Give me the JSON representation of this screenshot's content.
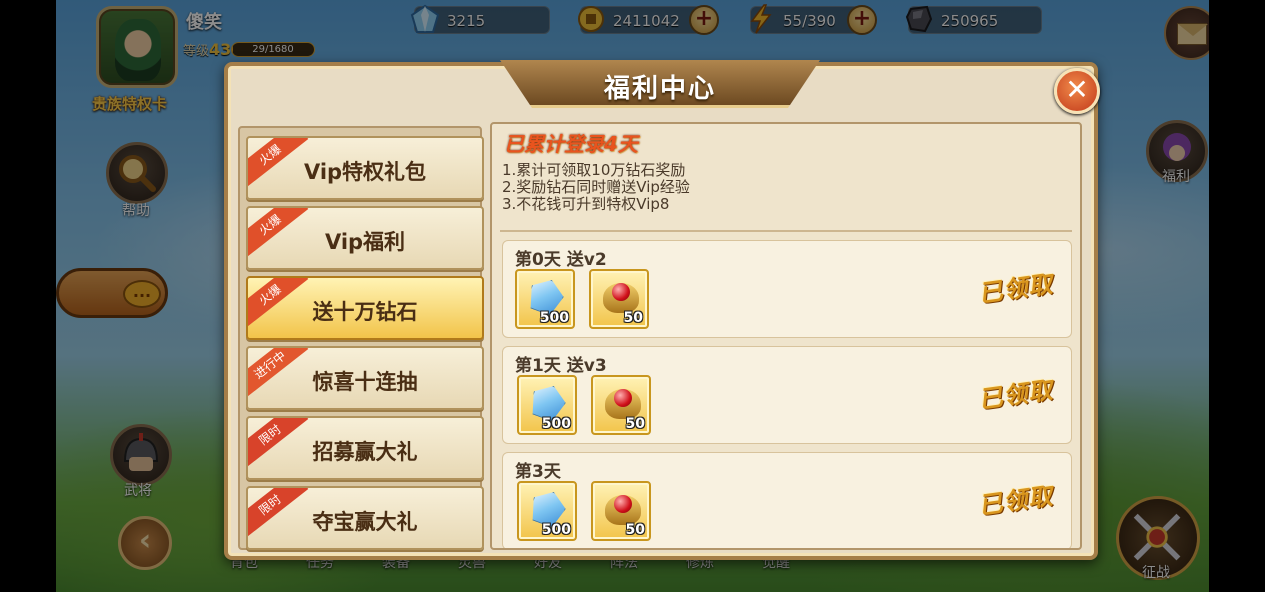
{
  "header": {
    "player_name": "傻笑",
    "level_label": "等级",
    "level": "43",
    "exp_text": "29/1680",
    "exp_progress": 0.017,
    "privilege_card_label": "贵族特权卡",
    "resources": [
      {
        "name": "diamond",
        "icon": "diamond-icon",
        "value": "3215"
      },
      {
        "name": "gold",
        "icon": "coin-icon",
        "value": "2411042"
      },
      {
        "name": "stamina",
        "icon": "lightning-icon",
        "value": "55/390"
      },
      {
        "name": "stone",
        "icon": "stone-icon",
        "value": "250965"
      }
    ]
  },
  "side": {
    "help_label": "帮助",
    "welfare_label": "福利",
    "general_label": "武将",
    "battle_label": "征战",
    "chat_icon": "..."
  },
  "bottom_tabs": [
    "背包",
    "任务",
    "装备",
    "灵兽",
    "好友",
    "阵法",
    "修炼",
    "觉醒"
  ],
  "dialog": {
    "title": "福利中心",
    "close_icon": "✕",
    "menu": [
      {
        "label": "Vip特权礼包",
        "tag": "火爆",
        "active": false
      },
      {
        "label": "Vip福利",
        "tag": "火爆",
        "active": false
      },
      {
        "label": "送十万钻石",
        "tag": "火爆",
        "active": true
      },
      {
        "label": "惊喜十连抽",
        "tag": "进行中",
        "active": false
      },
      {
        "label": "招募赢大礼",
        "tag": "限时",
        "active": false
      },
      {
        "label": "夺宝赢大礼",
        "tag": "限时",
        "active": false
      }
    ],
    "content": {
      "login_days": "已累计登录4天",
      "descriptions": [
        "1.累计可领取10万钻石奖励",
        "2.奖励钻石同时赠送Vip经验",
        "3.不花钱可升到特权Vip8"
      ],
      "days": [
        {
          "title": "第0天 送v2",
          "rewards": [
            {
              "type": "diamond",
              "qty": "500"
            },
            {
              "type": "vip-orb",
              "qty": "50"
            }
          ],
          "status": "已领取"
        },
        {
          "title": "第1天 送v3",
          "rewards": [
            {
              "type": "diamond",
              "qty": "500"
            },
            {
              "type": "vip-orb",
              "qty": "50"
            }
          ],
          "status": "已领取"
        },
        {
          "title": "第3天",
          "rewards": [
            {
              "type": "diamond",
              "qty": "500"
            },
            {
              "type": "vip-orb",
              "qty": "50"
            }
          ],
          "status": "已领取"
        }
      ]
    }
  },
  "colors": {
    "accent_gold": "#f2c44a",
    "close_red": "#c1381a",
    "ribbon_red": "#e0502a",
    "claimed_gold": "#d9961e"
  }
}
